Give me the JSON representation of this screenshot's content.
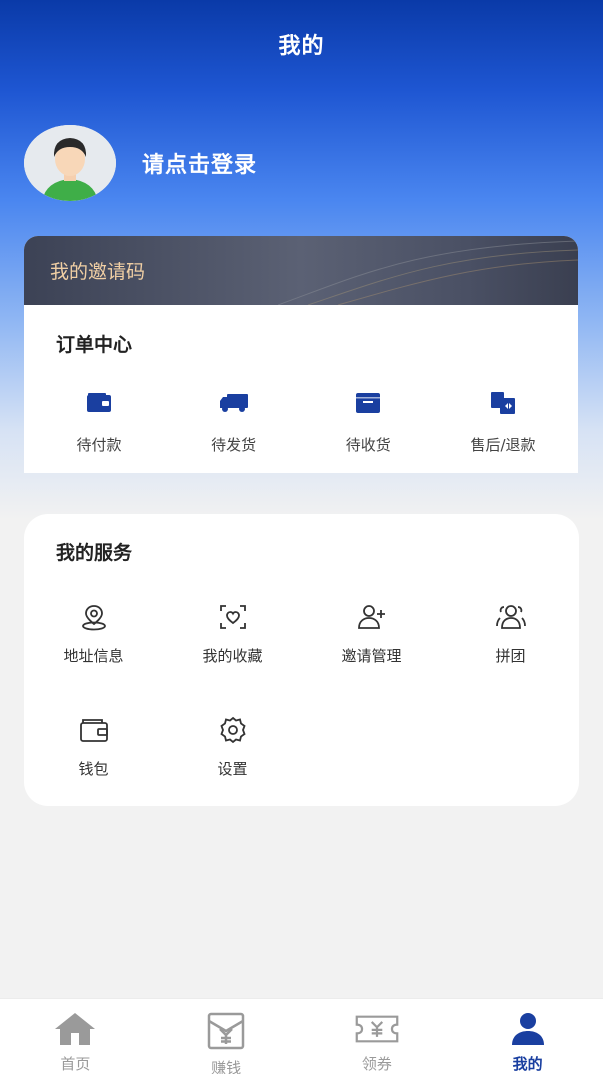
{
  "header": {
    "title": "我的"
  },
  "profile": {
    "login_prompt": "请点击登录"
  },
  "invite": {
    "label": "我的邀请码"
  },
  "orders": {
    "title": "订单中心",
    "items": [
      {
        "label": "待付款",
        "icon": "wallet-icon"
      },
      {
        "label": "待发货",
        "icon": "truck-icon"
      },
      {
        "label": "待收货",
        "icon": "box-icon"
      },
      {
        "label": "售后/退款",
        "icon": "refund-icon"
      }
    ]
  },
  "services": {
    "title": "我的服务",
    "items": [
      {
        "label": "地址信息",
        "icon": "location-icon"
      },
      {
        "label": "我的收藏",
        "icon": "heart-icon"
      },
      {
        "label": "邀请管理",
        "icon": "add-user-icon"
      },
      {
        "label": "拼团",
        "icon": "group-icon"
      },
      {
        "label": "钱包",
        "icon": "wallet-icon"
      },
      {
        "label": "设置",
        "icon": "gear-icon"
      }
    ]
  },
  "tabbar": {
    "items": [
      {
        "label": "首页",
        "icon": "home-icon",
        "active": false
      },
      {
        "label": "赚钱",
        "icon": "yuan-envelope-icon",
        "active": false
      },
      {
        "label": "领券",
        "icon": "coupon-icon",
        "active": false
      },
      {
        "label": "我的",
        "icon": "user-icon",
        "active": true
      }
    ]
  },
  "colors": {
    "primary": "#1a3fa0",
    "accent_gold": "#f0cfa4",
    "tab_inactive": "#9a9a9a"
  }
}
